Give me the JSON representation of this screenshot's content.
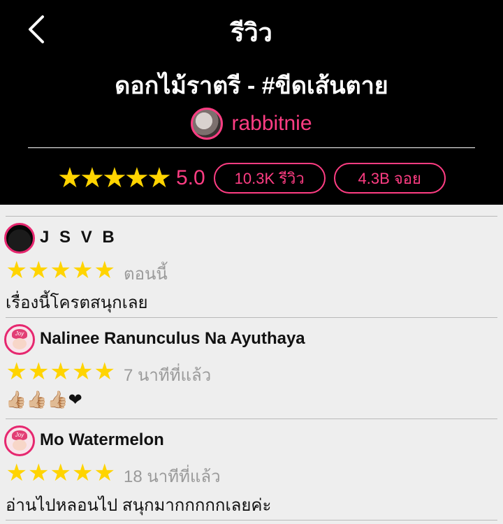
{
  "header": {
    "page_title": "รีวิว",
    "book_title": "ดอกไม้ราตรี - #ขีดเส้นตาย",
    "author": "rabbitnie",
    "rating": "5.0",
    "review_count": "10.3K รีวิว",
    "view_count": "4.3B จอย",
    "accent_color": "#ff3d83",
    "star_color": "#ffd400",
    "star_rating": 5
  },
  "reviews": [
    {
      "name": "J S V B",
      "stars": 5,
      "time": "ตอนนี้",
      "text": "เรื่องนี้โครตสนุกเลย",
      "avatar": "dark-avatar"
    },
    {
      "name": "Nalinee Ranunculus Na Ayuthaya",
      "stars": 5,
      "time": "7 นาทีที่แล้ว",
      "text": "👍🏼👍🏼👍🏼❤",
      "avatar": "joy-avatar"
    },
    {
      "name": "Mo Watermelon",
      "stars": 5,
      "time": "18 นาทีที่แล้ว",
      "text": "อ่านไปหลอนไป สนุกมากกกกกเลยค่ะ",
      "avatar": "joy-avatar"
    }
  ]
}
